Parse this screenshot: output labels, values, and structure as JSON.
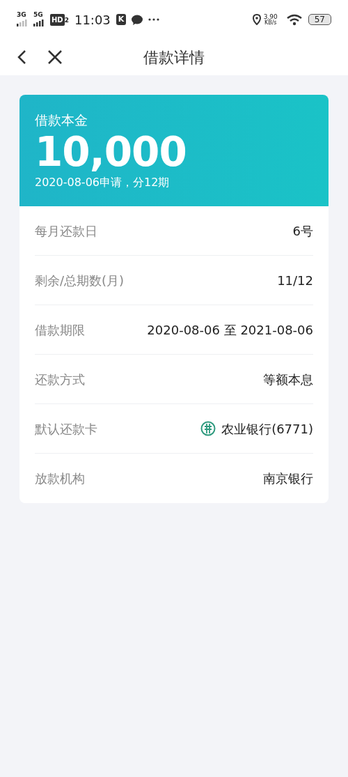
{
  "status_bar": {
    "signals": [
      "3G",
      "5G"
    ],
    "hd": "HD",
    "hd_sub": "2",
    "time": "11:03",
    "app_badge": "K",
    "speed": "3.90",
    "speed_unit": "KB/s",
    "battery": "57"
  },
  "nav": {
    "title": "借款详情"
  },
  "loan": {
    "label": "借款本金",
    "amount": "10,000",
    "note": "2020-08-06申请，分12期"
  },
  "rows": [
    {
      "label": "每月还款日",
      "value": "6号"
    },
    {
      "label": "剩余/总期数(月)",
      "value": "11/12"
    },
    {
      "label": "借款期限",
      "value": "2020-08-06 至 2021-08-06"
    },
    {
      "label": "还款方式",
      "value": "等额本息"
    },
    {
      "label": "默认还款卡",
      "value": "农业银行(6771)",
      "kind": "bank"
    },
    {
      "label": "放款机构",
      "value": "南京银行"
    }
  ]
}
